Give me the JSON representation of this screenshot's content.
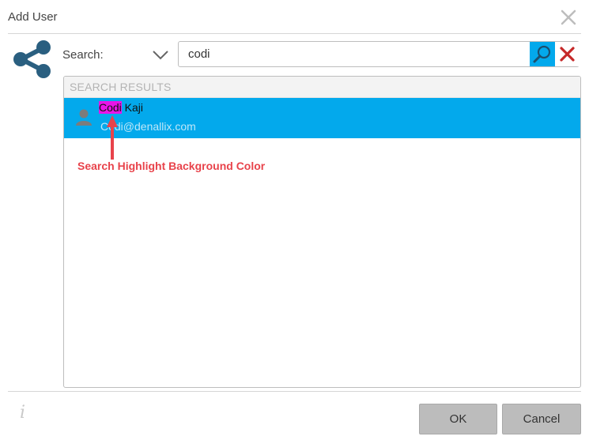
{
  "dialog": {
    "title": "Add User"
  },
  "search": {
    "label": "Search:",
    "value": "codi"
  },
  "results": {
    "header": "SEARCH RESULTS",
    "items": [
      {
        "name_highlight": "Codi",
        "name_rest": " Kaji",
        "email": "Codi@denallix.com"
      }
    ]
  },
  "annotation": {
    "text": "Search Highlight Background Color"
  },
  "footer": {
    "info": "i",
    "ok_label": "OK",
    "cancel_label": "Cancel"
  },
  "colors": {
    "accent": "#03a9ec",
    "highlight": "#e815e8",
    "annotation": "#e8434b",
    "icon": "#2a5f80",
    "clear": "#c62828"
  }
}
